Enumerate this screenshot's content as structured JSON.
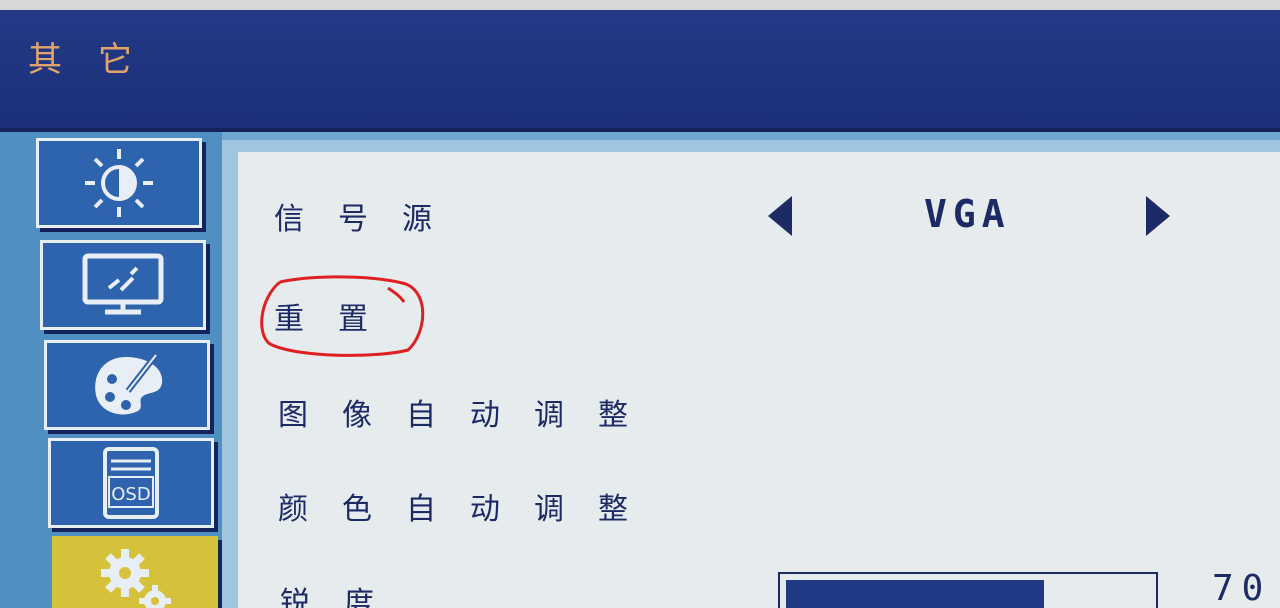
{
  "window": {
    "title": "其它"
  },
  "sidebar": {
    "items": [
      {
        "icon": "brightness-icon",
        "active": false
      },
      {
        "icon": "monitor-icon",
        "active": false
      },
      {
        "icon": "palette-icon",
        "active": false
      },
      {
        "icon": "osd-icon",
        "label": "OSD",
        "active": false
      },
      {
        "icon": "gears-icon",
        "active": true
      }
    ]
  },
  "menu": {
    "items": [
      {
        "label": "信号源"
      },
      {
        "label": "重置"
      },
      {
        "label": "图像自动调整"
      },
      {
        "label": "颜色自动调整"
      },
      {
        "label": "锐度"
      }
    ]
  },
  "signal_source": {
    "value": "VGA"
  },
  "sharpness": {
    "value": "70",
    "level": 0.7
  },
  "colors": {
    "title_bar": "#233a86",
    "title_text": "#e0a46a",
    "menu_text": "#1c2a66",
    "active_tab": "#d6c23a",
    "annotation": "#e02020"
  }
}
